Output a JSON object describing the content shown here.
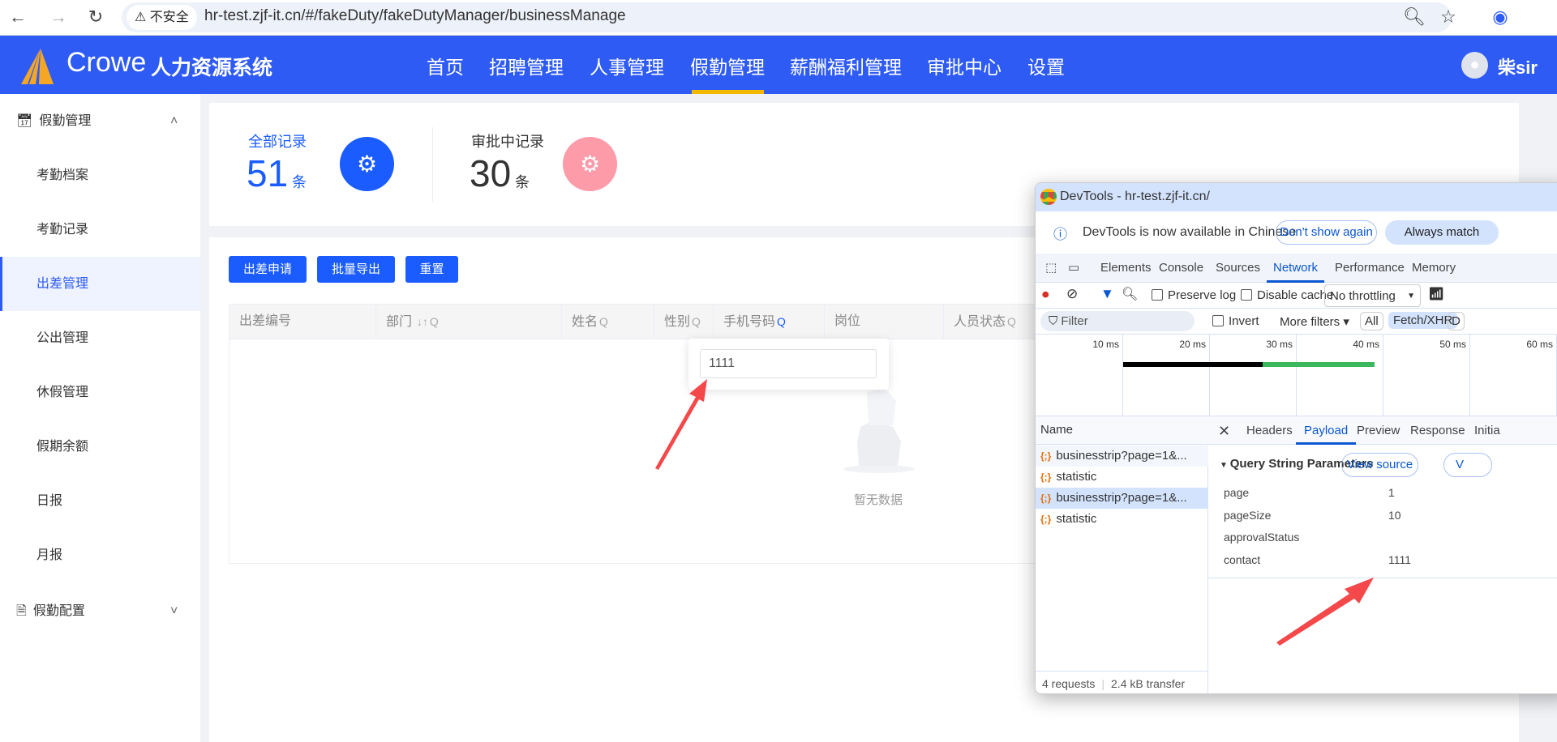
{
  "browser": {
    "url": "hr-test.zjf-it.cn/#/fakeDuty/fakeDutyManager/businessManage",
    "security": "不安全",
    "back_icon": "arrow-left",
    "forward_icon": "arrow-right",
    "reload_icon": "reload"
  },
  "header": {
    "brand": "Crowe",
    "system": "人力资源系统",
    "nav": [
      "首页",
      "招聘管理",
      "人事管理",
      "假勤管理",
      "薪酬福利管理",
      "审批中心",
      "设置"
    ],
    "active_nav": "假勤管理",
    "user": "柴sir",
    "accent": "#2f5bf5",
    "active_underline": "#f5b800"
  },
  "sidebar": {
    "group1": "假勤管理",
    "items": [
      "考勤档案",
      "考勤记录",
      "出差管理",
      "公出管理",
      "休假管理",
      "假期余额",
      "日报",
      "月报"
    ],
    "active": "出差管理",
    "group2": "假勤配置"
  },
  "stats": {
    "all_label": "全部记录",
    "all_count": "51",
    "unit": "条",
    "pending_label": "审批中记录",
    "pending_count": "30"
  },
  "toolbar": {
    "apply": "出差申请",
    "export": "批量导出",
    "reset": "重置"
  },
  "table": {
    "columns": [
      "出差编号",
      "部门",
      "姓名",
      "性别",
      "手机号码",
      "岗位",
      "人员状态"
    ],
    "empty": "暂无数据"
  },
  "filter_popover": {
    "value": "1111"
  },
  "devtools": {
    "title": "DevTools - hr-test.zjf-it.cn/",
    "info": "DevTools is now available in Chinese",
    "dont_show": "Don't show again",
    "always_match": "Always match",
    "tabs": [
      "Elements",
      "Console",
      "Sources",
      "Network",
      "Performance",
      "Memory"
    ],
    "active_tab": "Network",
    "preserve_log": "Preserve log",
    "disable_cache": "Disable cache",
    "throttling": "No throttling",
    "filter": "Filter",
    "invert": "Invert",
    "more_filters": "More filters",
    "type_all": "All",
    "type_xhr": "Fetch/XHR",
    "type_doc": "D",
    "timeline": [
      "10 ms",
      "20 ms",
      "30 ms",
      "40 ms",
      "50 ms",
      "60 ms"
    ],
    "name_header": "Name",
    "requests": [
      "businesstrip?page=1&...",
      "statistic",
      "businesstrip?page=1&...",
      "statistic"
    ],
    "footer_requests": "4 requests",
    "footer_transfer": "2.4 kB transfer",
    "detail_tabs": [
      "Headers",
      "Payload",
      "Preview",
      "Response",
      "Initia"
    ],
    "active_detail": "Payload",
    "section": "Query String Parameters",
    "view_source": "View source",
    "view_enc": "V",
    "params": [
      {
        "key": "page",
        "value": "1"
      },
      {
        "key": "pageSize",
        "value": "10"
      },
      {
        "key": "approvalStatus",
        "value": ""
      },
      {
        "key": "contact",
        "value": "1111"
      }
    ]
  }
}
